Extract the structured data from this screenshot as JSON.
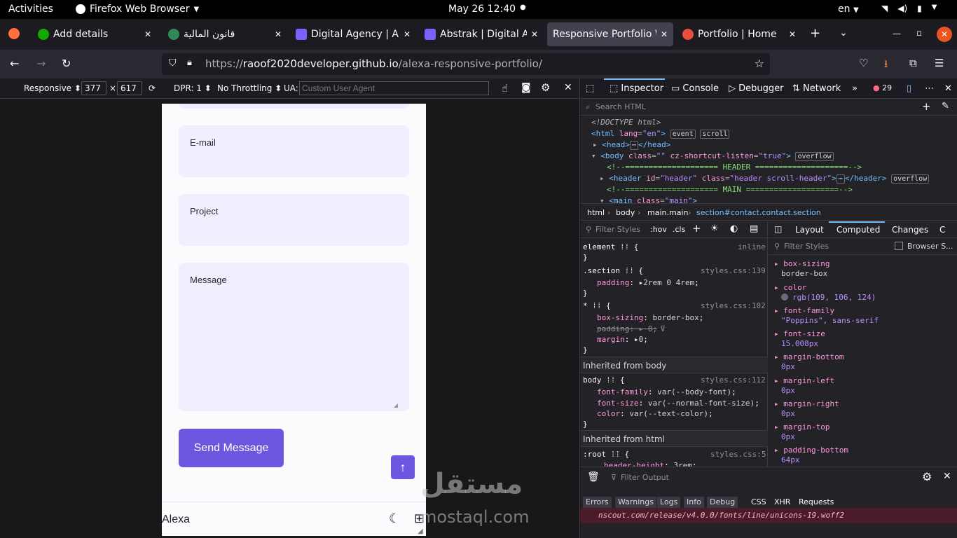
{
  "system": {
    "activities": "Activities",
    "app_name": "Firefox Web Browser",
    "clock": "May 26  12:40",
    "language": "en"
  },
  "tabs": [
    {
      "title": "Add details",
      "favicon_color": "#14a800"
    },
    {
      "title": "قانون المالية",
      "favicon_color": "#2e8b57"
    },
    {
      "title": "Digital Agency | Ab",
      "favicon_color": "#7b61ff"
    },
    {
      "title": "Abstrak | Digital Ag",
      "favicon_color": "#7b61ff"
    },
    {
      "title": "Responsive Portfolio W",
      "favicon_color": ""
    },
    {
      "title": "Portfolio | Home",
      "favicon_color": "#e94e3c"
    }
  ],
  "url": {
    "prefix": "https://",
    "domain": "raoof2020developer.github.io",
    "path": "/alexa-responsive-portfolio/"
  },
  "rdm": {
    "mode": "Responsive",
    "width": "377",
    "times": "×",
    "height": "617",
    "dpr": "DPR: 1",
    "throttling": "No Throttling",
    "ua_label": "UA:",
    "ua_placeholder": "Custom User Agent"
  },
  "devtools": {
    "tabs": [
      "Inspector",
      "Console",
      "Debugger",
      "Network"
    ],
    "error_count": "29",
    "search_placeholder": "Search HTML",
    "breadcrumbs": [
      "html",
      "body",
      "main.main",
      "section#contact.contact.section"
    ],
    "rules_filter": "Filter Styles",
    "hov": ":hov",
    "cls": ".cls",
    "side_tabs": [
      "Layout",
      "Computed",
      "Changes",
      "C"
    ],
    "computed_filter": "Filter Styles",
    "browser_styles": "Browser S...",
    "inherited_body": "Inherited from body",
    "inherited_html": "Inherited from html",
    "computed": [
      {
        "prop": "box-sizing",
        "value": "border-box"
      },
      {
        "prop": "color",
        "value": "rgb(109, 106, 124)"
      },
      {
        "prop": "font-family",
        "value": "\"Poppins\", sans-serif"
      },
      {
        "prop": "font-size",
        "value": "15.008px"
      },
      {
        "prop": "margin-bottom",
        "value": "0px"
      },
      {
        "prop": "margin-left",
        "value": "0px"
      },
      {
        "prop": "margin-right",
        "value": "0px"
      },
      {
        "prop": "margin-top",
        "value": "0px"
      },
      {
        "prop": "padding-bottom",
        "value": "64px"
      }
    ],
    "console": {
      "filter": "Filter Output",
      "filters": [
        "Errors",
        "Warnings",
        "Logs",
        "Info",
        "Debug"
      ],
      "types": [
        "CSS",
        "XHR",
        "Requests"
      ],
      "error_text": "nscout.com/release/v4.0.0/fonts/line/unicons-19.woff2"
    }
  },
  "page": {
    "fields": [
      "E-mail",
      "Project",
      "Message"
    ],
    "send_button": "Send Message",
    "logo": "Alexa"
  },
  "watermark": {
    "arabic": "مستقل",
    "latin": "mostaql.com"
  }
}
